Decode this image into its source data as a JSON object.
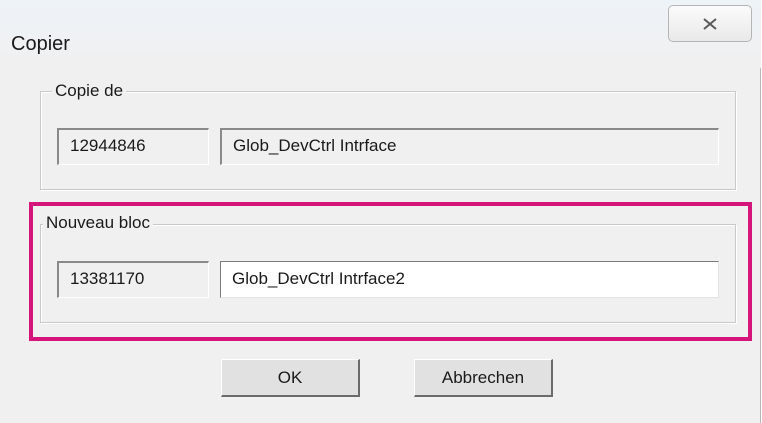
{
  "window": {
    "title": "Copier",
    "close_icon": "close-x-icon"
  },
  "copy_from": {
    "label": "Copie de",
    "number": "12944846",
    "name": "Glob_DevCtrl Intrface"
  },
  "new_block": {
    "label": "Nouveau bloc",
    "number": "13381170",
    "name": "Glob_DevCtrl Intrface2"
  },
  "buttons": {
    "ok_label": "OK",
    "cancel_label": "Abbrechen"
  },
  "colors": {
    "highlight": "#d6157a",
    "dialog_background": "#f0f0f0"
  }
}
